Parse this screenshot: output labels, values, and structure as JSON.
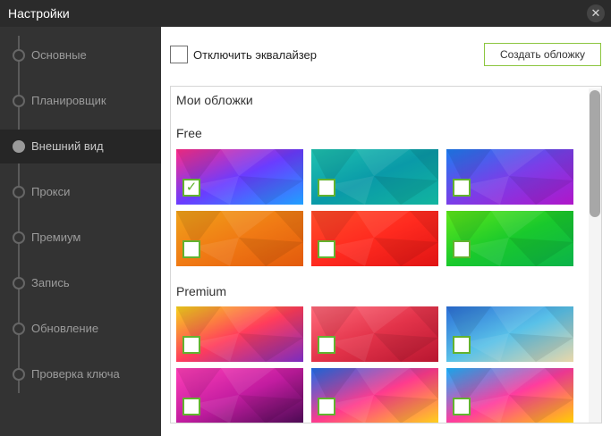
{
  "window": {
    "title": "Настройки",
    "close_glyph": "✕"
  },
  "sidebar": {
    "items": [
      {
        "label": "Основные",
        "active": false
      },
      {
        "label": "Планировщик",
        "active": false
      },
      {
        "label": "Внешний вид",
        "active": true
      },
      {
        "label": "Прокси",
        "active": false
      },
      {
        "label": "Премиум",
        "active": false
      },
      {
        "label": "Запись",
        "active": false
      },
      {
        "label": "Обновление",
        "active": false
      },
      {
        "label": "Проверка ключа",
        "active": false
      }
    ]
  },
  "content": {
    "disable_equalizer_label": "Отключить эквалайзер",
    "disable_equalizer_checked": false,
    "create_skin_label": "Создать обложку",
    "skins_title": "Мои обложки",
    "groups": [
      {
        "label": "Free"
      },
      {
        "label": "Premium"
      }
    ],
    "skins_free": [
      {
        "name": "pink-polygon",
        "checked": true,
        "colors": [
          "#ff2d8a",
          "#6a3cff",
          "#1fa0ff"
        ]
      },
      {
        "name": "teal",
        "checked": false,
        "colors": [
          "#1fc2b0",
          "#0a9aa8",
          "#12b59f"
        ]
      },
      {
        "name": "blue-purple",
        "checked": false,
        "colors": [
          "#1d7cf0",
          "#7a3ee8",
          "#b016c9"
        ]
      },
      {
        "name": "orange",
        "checked": false,
        "colors": [
          "#f0a21a",
          "#f07a14",
          "#e35a0c"
        ]
      },
      {
        "name": "red",
        "checked": false,
        "colors": [
          "#ff4d2a",
          "#ff2a1f",
          "#e01414"
        ]
      },
      {
        "name": "green",
        "checked": false,
        "colors": [
          "#5fe81a",
          "#19c92c",
          "#0bb34a"
        ]
      }
    ],
    "skins_premium": [
      {
        "name": "rainbow-triangles",
        "checked": false,
        "colors": [
          "#f7d21d",
          "#ff3c5c",
          "#7a2cbf"
        ]
      },
      {
        "name": "red-polygon",
        "checked": false,
        "colors": [
          "#ff6a7a",
          "#e3334a",
          "#b81630"
        ]
      },
      {
        "name": "beach",
        "checked": false,
        "colors": [
          "#2b6fd8",
          "#59c1e8",
          "#e9d7a9"
        ]
      },
      {
        "name": "bridge-night",
        "checked": false,
        "colors": [
          "#ff3fb7",
          "#c21ca0",
          "#4a0a52"
        ]
      },
      {
        "name": "candy-rainbow",
        "checked": false,
        "colors": [
          "#1e6ce8",
          "#ff3b8d",
          "#ffd21a"
        ]
      },
      {
        "name": "abstract-swirl",
        "checked": false,
        "colors": [
          "#1bb4ff",
          "#ff3c9e",
          "#ffd000"
        ]
      }
    ]
  },
  "colors": {
    "accent": "#8cc63f",
    "check_green": "#62b22f"
  }
}
